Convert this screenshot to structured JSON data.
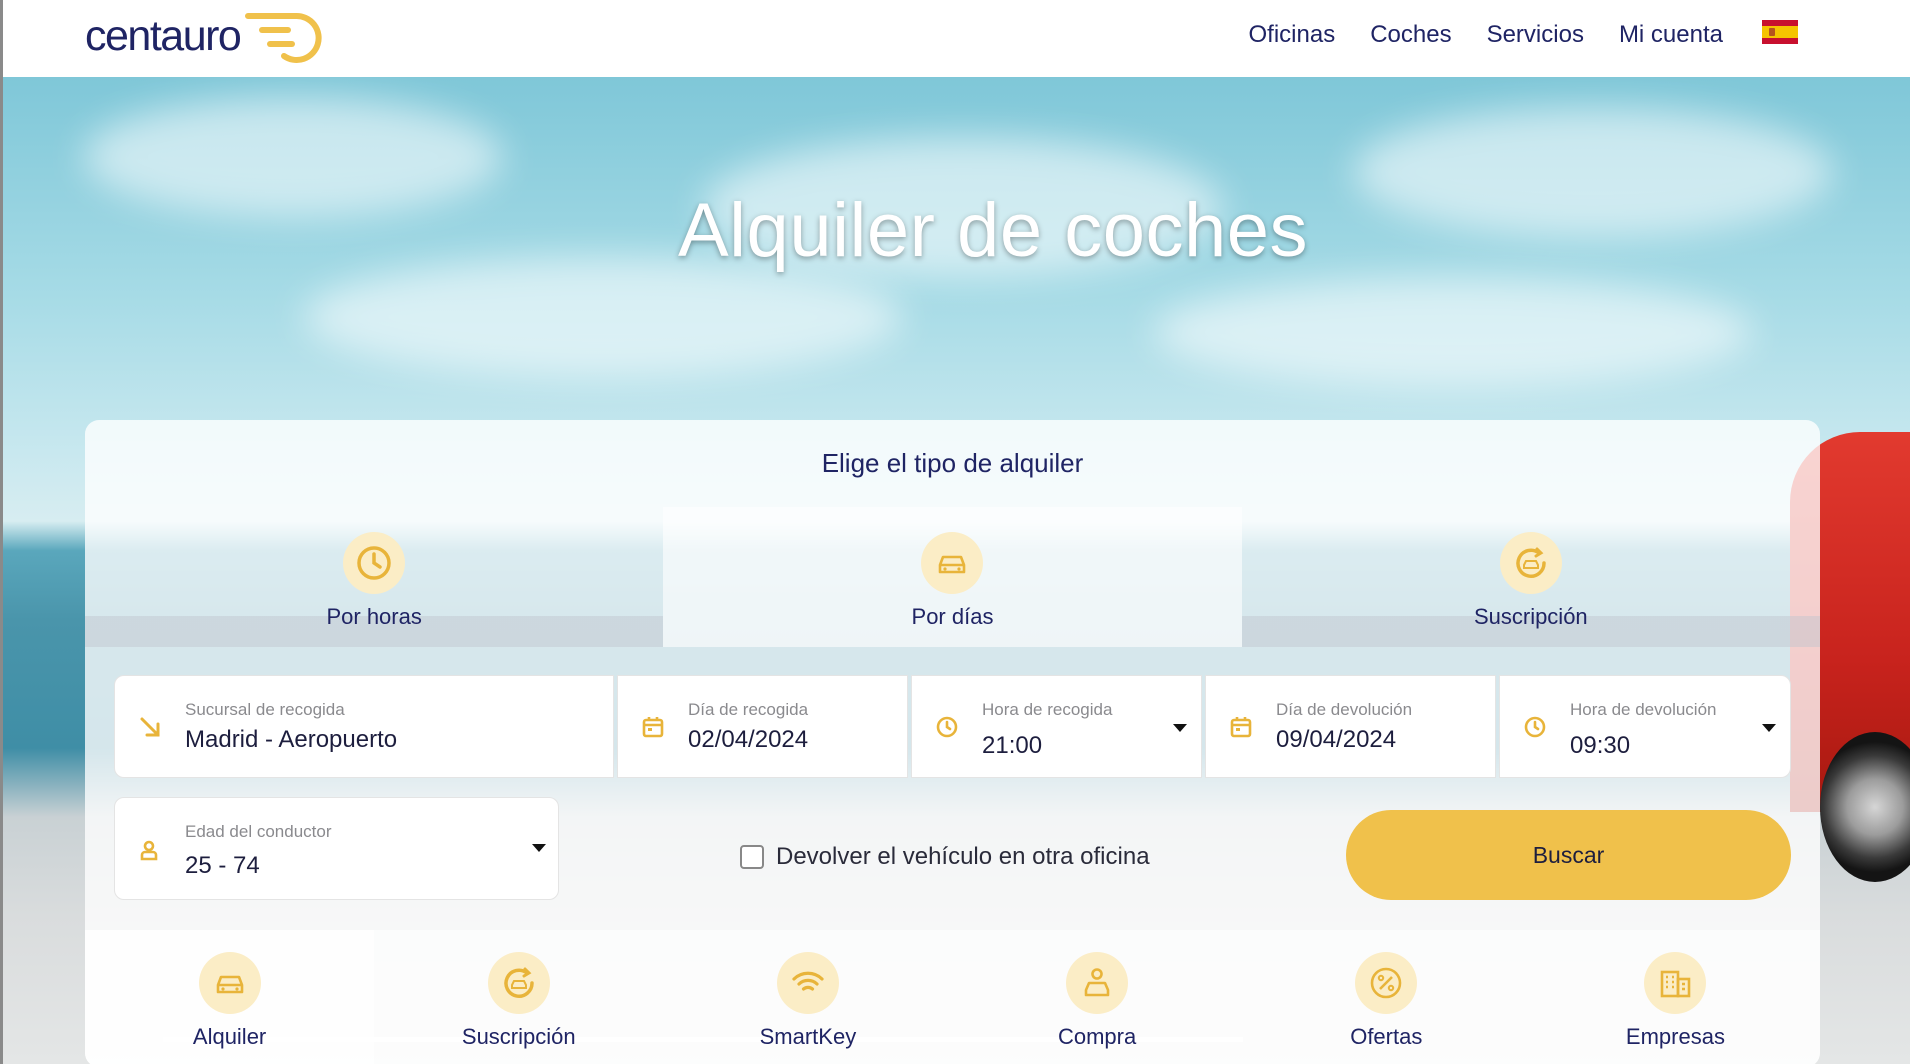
{
  "header": {
    "logo_text": "centauro",
    "nav": [
      "Oficinas",
      "Coches",
      "Servicios",
      "Mi cuenta"
    ],
    "language_flag": "spain-flag-icon"
  },
  "hero": {
    "title": "Alquiler de coches"
  },
  "search": {
    "panel_title": "Elige el tipo de alquiler",
    "tabs": [
      {
        "label": "Por horas",
        "icon": "clock-icon"
      },
      {
        "label": "Por días",
        "icon": "car-icon",
        "active": true
      },
      {
        "label": "Suscripción",
        "icon": "subscription-icon"
      }
    ],
    "fields": {
      "pickup_branch": {
        "label": "Sucursal de recogida",
        "value": "Madrid - Aeropuerto"
      },
      "pickup_date": {
        "label": "Día de recogida",
        "value": "02/04/2024"
      },
      "pickup_time": {
        "label": "Hora de recogida",
        "value": "21:00"
      },
      "return_date": {
        "label": "Día de devolución",
        "value": "09/04/2024"
      },
      "return_time": {
        "label": "Hora de devolución",
        "value": "09:30"
      },
      "driver_age": {
        "label": "Edad del conductor",
        "value": "25 - 74"
      }
    },
    "other_office_label": "Devolver el vehículo en otra oficina",
    "search_button": "Buscar"
  },
  "bottom_nav": [
    {
      "label": "Alquiler",
      "icon": "car-icon",
      "active": true
    },
    {
      "label": "Suscripción",
      "icon": "subscription-icon"
    },
    {
      "label": "SmartKey",
      "icon": "wifi-icon"
    },
    {
      "label": "Compra",
      "icon": "buy-car-icon"
    },
    {
      "label": "Ofertas",
      "icon": "discount-icon"
    },
    {
      "label": "Empresas",
      "icon": "building-icon"
    }
  ],
  "colors": {
    "brand_navy": "#1f2464",
    "accent_yellow": "#f0c14b",
    "icon_bg": "#fbedc6",
    "icon_gold": "#e8b43a"
  }
}
